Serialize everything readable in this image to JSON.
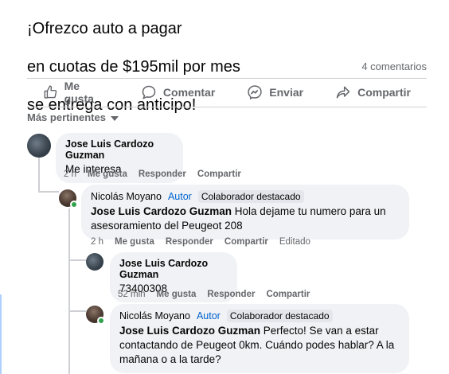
{
  "post": {
    "lines": [
      "¡Ofrezco auto a pagar",
      "en cuotas de $195mil por mes",
      "se entrega con anticipo!"
    ],
    "comment_count": "4 comentarios"
  },
  "actions": {
    "like": "Me gusta",
    "comment": "Comentar",
    "send": "Enviar",
    "share": "Compartir"
  },
  "sort": {
    "label": "Más pertinentes"
  },
  "comments": [
    {
      "author": "Jose Luis Cardozo Guzman",
      "text": "Me interesa",
      "time": "2 h",
      "like": "Me gusta",
      "reply": "Responder",
      "share": "Compartir"
    },
    {
      "author": "Nicolás Moyano",
      "badge_author": "Autor",
      "badge_top": "Colaborador destacado",
      "mention": "Jose Luis Cardozo Guzman",
      "text": " Hola dejame tu numero para un asesoramiento del Peugeot 208",
      "time": "2 h",
      "like": "Me gusta",
      "reply": "Responder",
      "share": "Compartir",
      "edited": "Editado"
    },
    {
      "author": "Jose Luis Cardozo Guzman",
      "text": "73400308",
      "time": "52 min",
      "like": "Me gusta",
      "reply": "Responder",
      "share": "Compartir"
    },
    {
      "author": "Nicolás Moyano",
      "badge_author": "Autor",
      "badge_top": "Colaborador destacado",
      "mention": "Jose Luis Cardozo Guzman",
      "text": " Perfecto! Se van a estar contactando de Peugeot 0km. Cuándo podes hablar? A la mañana o a la tarde?"
    }
  ],
  "colors": {
    "link_blue": "#0064d1",
    "online_green": "#31a24c",
    "bubble_bg": "#f0f2f5"
  }
}
